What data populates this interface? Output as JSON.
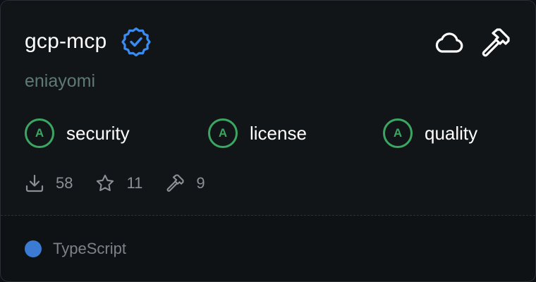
{
  "card": {
    "title": "gcp-mcp",
    "author": "eniayomi",
    "verified_icon": "verified-badge-icon",
    "top_icons": [
      "cloud-icon",
      "hammer-icon"
    ]
  },
  "grades": [
    {
      "grade": "A",
      "label": "security"
    },
    {
      "grade": "A",
      "label": "license"
    },
    {
      "grade": "A",
      "label": "quality"
    }
  ],
  "stats": {
    "downloads": "58",
    "stars": "11",
    "tools": "9"
  },
  "language": {
    "name": "TypeScript",
    "color": "#3b7bd4"
  },
  "colors": {
    "grade_accent": "#3aa662",
    "verified_accent": "#3b8cf0",
    "author_text": "#5f7a74",
    "background": "#111518"
  }
}
